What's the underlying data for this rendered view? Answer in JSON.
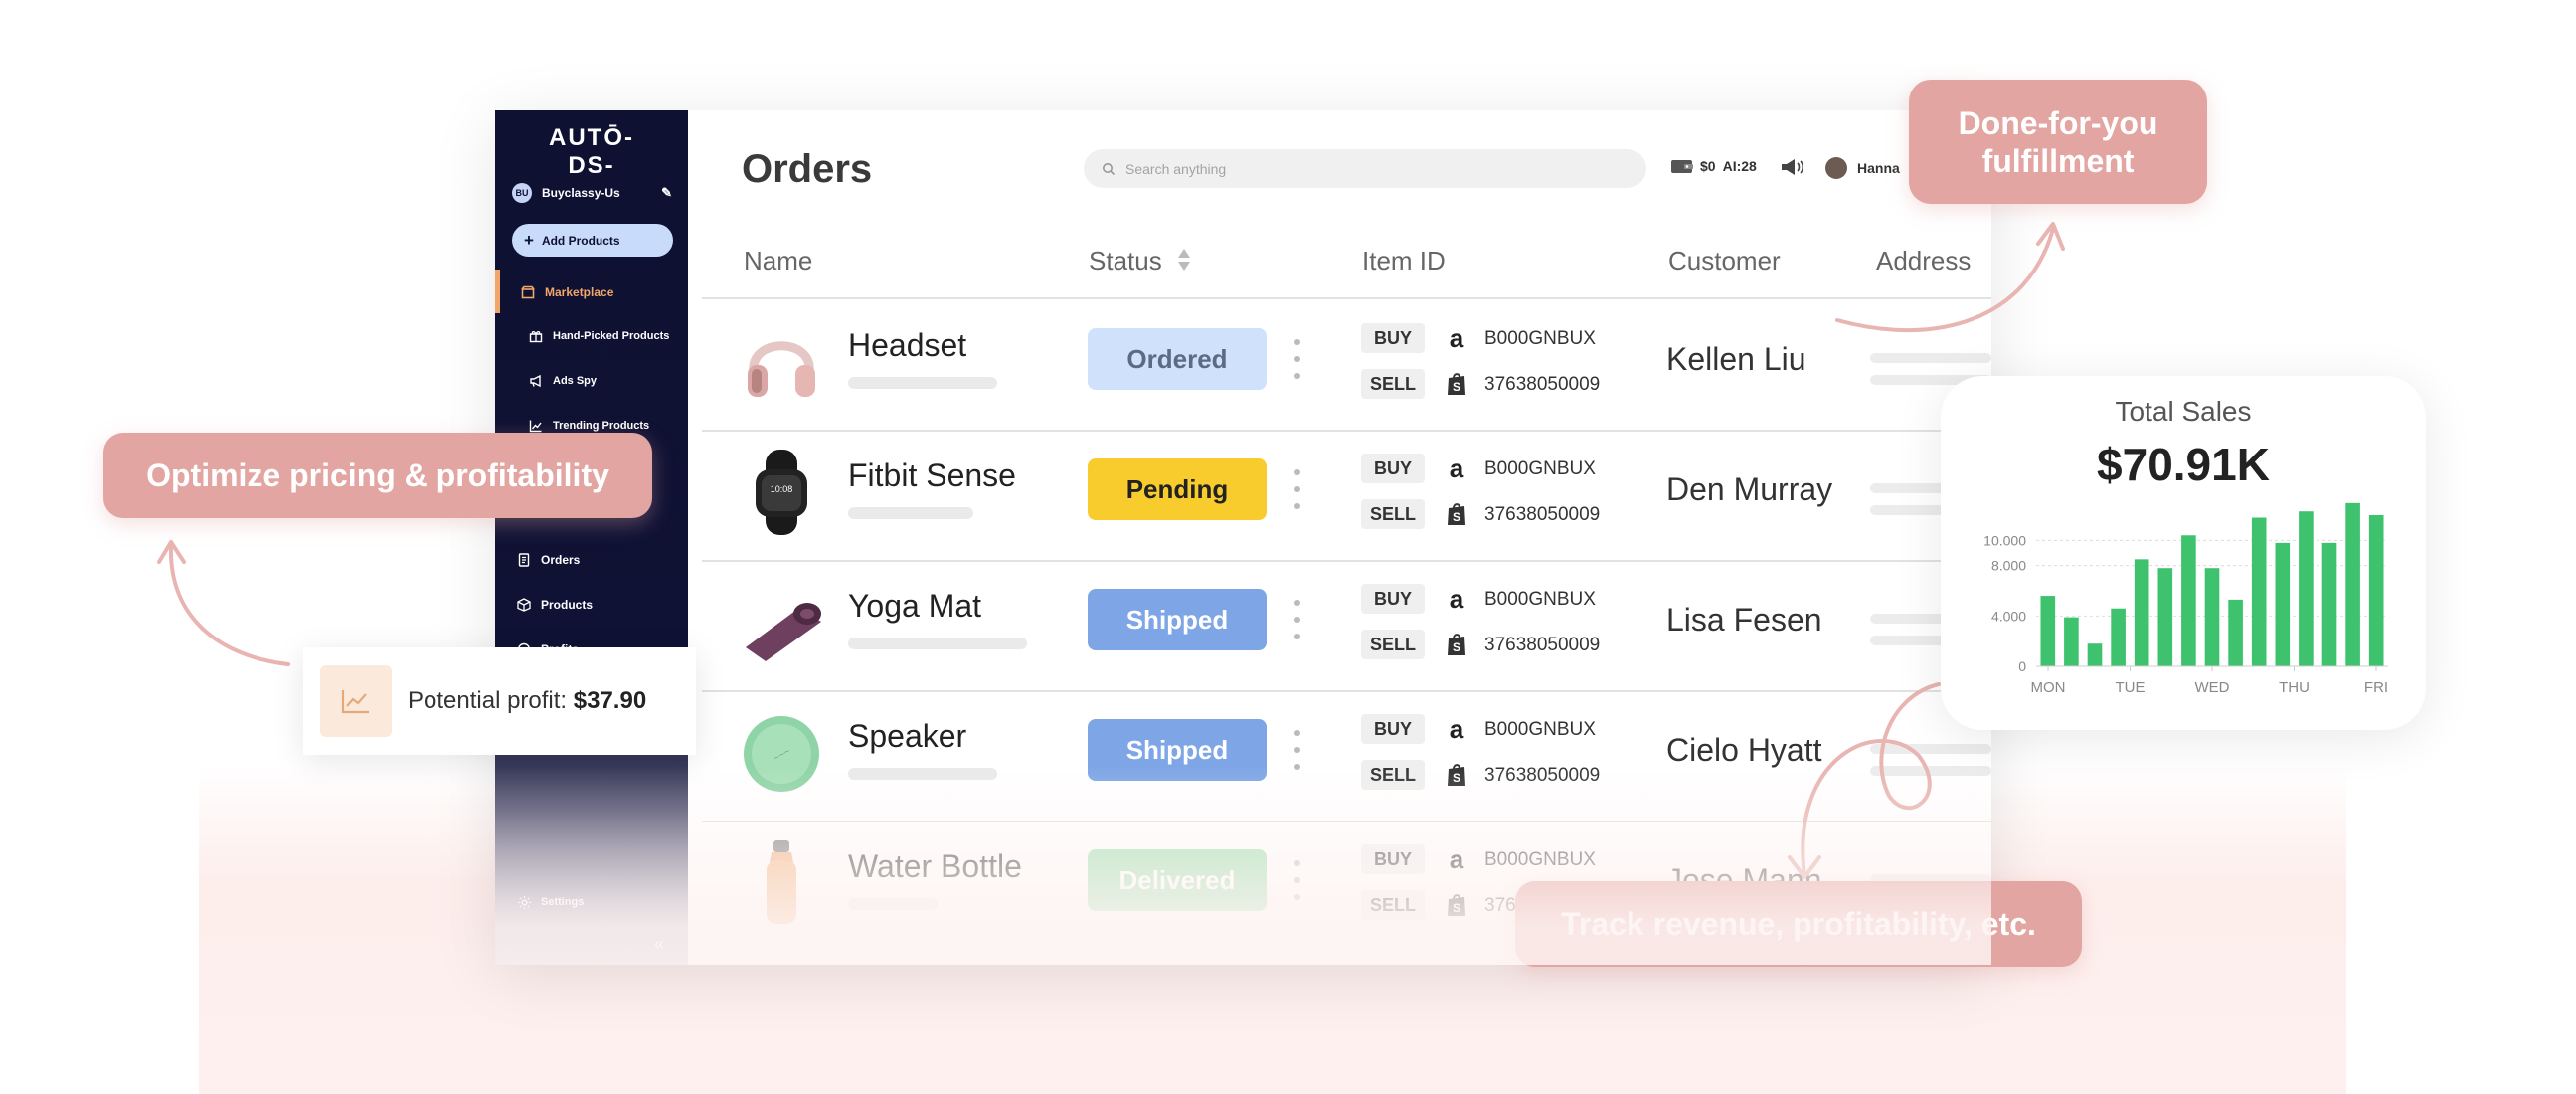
{
  "brand": {
    "logo_text": "AUTŌ-DS-"
  },
  "sidebar": {
    "store_initials": "BU",
    "store_name": "Buyclassy-Us",
    "add_products_label": "Add Products",
    "marketplace_label": "Marketplace",
    "sub_items": [
      "Hand-Picked Products",
      "Ads Spy",
      "Trending Products"
    ],
    "items": [
      "Orders",
      "Products",
      "Profits"
    ],
    "settings_label": "Settings",
    "collapse_glyph": "«"
  },
  "header": {
    "title": "Orders",
    "search_placeholder": "Search anything",
    "balance": "$0",
    "ai_credits": "AI:28",
    "user_name": "Hanna"
  },
  "table": {
    "columns": [
      "Name",
      "Status",
      "Item ID",
      "Customer",
      "Address"
    ],
    "buy_label": "BUY",
    "sell_label": "SELL",
    "rows": [
      {
        "name": "Headset",
        "status": "Ordered",
        "buy_id": "B000GNBUX",
        "sell_id": "37638050009",
        "customer": "Kellen Liu"
      },
      {
        "name": "Fitbit Sense",
        "status": "Pending",
        "buy_id": "B000GNBUX",
        "sell_id": "37638050009",
        "customer": "Den Murray"
      },
      {
        "name": "Yoga Mat",
        "status": "Shipped",
        "buy_id": "B000GNBUX",
        "sell_id": "37638050009",
        "customer": "Lisa Fesen"
      },
      {
        "name": "Speaker",
        "status": "Shipped",
        "buy_id": "B000GNBUX",
        "sell_id": "37638050009",
        "customer": "Cielo Hyatt"
      },
      {
        "name": "Water Bottle",
        "status": "Delivered",
        "buy_id": "B000GNBUX",
        "sell_id": "37638050009",
        "customer": "Jose Mann"
      }
    ]
  },
  "status_colors": {
    "Ordered": {
      "bg": "#cfe1fb",
      "fg": "#5b6b84"
    },
    "Pending": {
      "bg": "#f9cc2e",
      "fg": "#222222"
    },
    "Shipped": {
      "bg": "#7ea6e6",
      "fg": "#ffffff"
    },
    "Delivered": {
      "bg": "#8fdca4",
      "fg": "#ffffff"
    }
  },
  "callouts": {
    "fulfillment": "Done-for-you fulfillment",
    "pricing": "Optimize pricing & profitability",
    "revenue": "Track revenue, profitability, etc."
  },
  "profit_card": {
    "label": "Potential profit:",
    "value": "$37.90"
  },
  "sales_card": {
    "title": "Total Sales",
    "value": "$70.91K",
    "chart_data": {
      "type": "bar",
      "ylim": [
        0,
        12000
      ],
      "yticks": [
        0,
        4000,
        8000,
        10000
      ],
      "ytick_labels": [
        "0",
        "4.000",
        "8.000",
        "10.000"
      ],
      "x_labels": [
        "MON",
        "TUE",
        "WED",
        "THU",
        "FRI"
      ],
      "values": [
        5600,
        3900,
        1800,
        4600,
        8500,
        7800,
        10400,
        7800,
        5300,
        11800,
        9800,
        12300,
        9800,
        13000,
        12000
      ],
      "bar_color": "#3fc26e",
      "grid": true
    }
  },
  "colors": {
    "accent_pink": "#e3a5a2",
    "sidebar_navy": "#0f1132",
    "marketplace_orange": "#f1a66a"
  }
}
